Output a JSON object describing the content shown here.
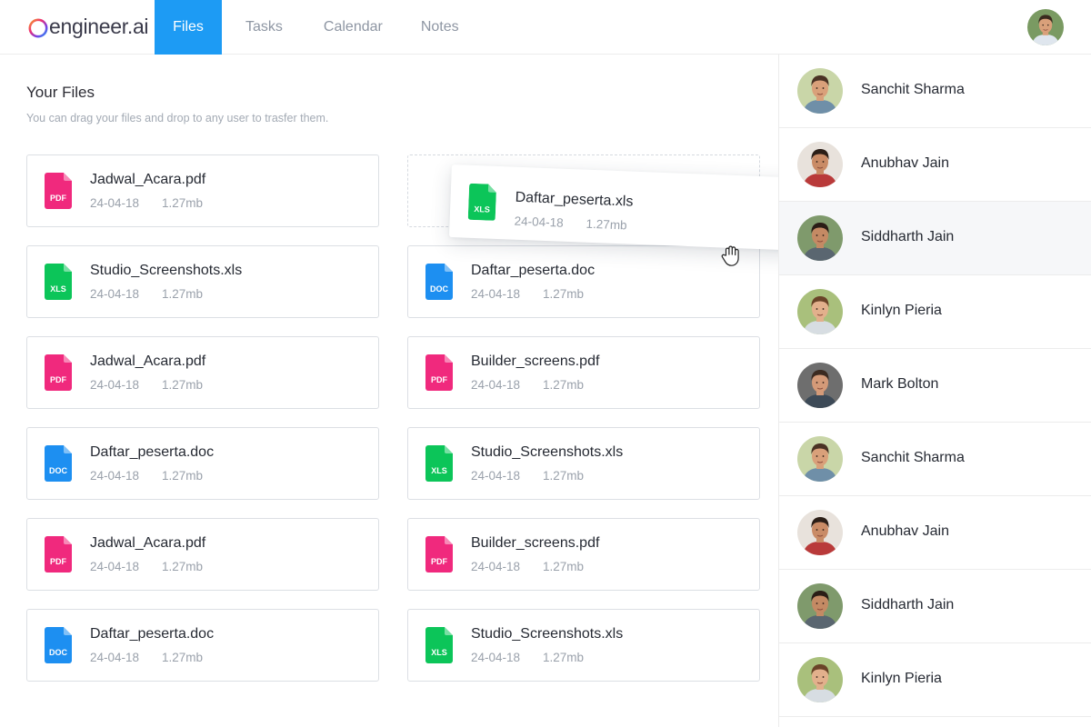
{
  "app": {
    "logo_text": "engineer.ai",
    "nav": [
      {
        "label": "Files",
        "active": true
      },
      {
        "label": "Tasks",
        "active": false
      },
      {
        "label": "Calendar",
        "active": false
      },
      {
        "label": "Notes",
        "active": false
      }
    ],
    "accent_color": "#1d9bf4"
  },
  "main": {
    "title": "Your Files",
    "subtitle": "You can drag your files and drop to any user to trasfer them."
  },
  "file_types": {
    "pdf": {
      "label": "PDF",
      "color": "#f0297d"
    },
    "xls": {
      "label": "XLS",
      "color": "#0cc559"
    },
    "doc": {
      "label": "DOC",
      "color": "#1d8ff1"
    }
  },
  "files": [
    {
      "name": "Jadwal_Acara.pdf",
      "type": "pdf",
      "date": "24-04-18",
      "size": "1.27mb"
    },
    {
      "name": "Studio_Screenshots.xls",
      "type": "xls",
      "date": "24-04-18",
      "size": "1.27mb"
    },
    {
      "name": "Daftar_peserta.doc",
      "type": "doc",
      "date": "24-04-18",
      "size": "1.27mb"
    },
    {
      "name": "Jadwal_Acara.pdf",
      "type": "pdf",
      "date": "24-04-18",
      "size": "1.27mb"
    },
    {
      "name": "Builder_screens.pdf",
      "type": "pdf",
      "date": "24-04-18",
      "size": "1.27mb"
    },
    {
      "name": "Daftar_peserta.doc",
      "type": "doc",
      "date": "24-04-18",
      "size": "1.27mb"
    },
    {
      "name": "Studio_Screenshots.xls",
      "type": "xls",
      "date": "24-04-18",
      "size": "1.27mb"
    },
    {
      "name": "Jadwal_Acara.pdf",
      "type": "pdf",
      "date": "24-04-18",
      "size": "1.27mb"
    },
    {
      "name": "Builder_screens.pdf",
      "type": "pdf",
      "date": "24-04-18",
      "size": "1.27mb"
    },
    {
      "name": "Daftar_peserta.doc",
      "type": "doc",
      "date": "24-04-18",
      "size": "1.27mb"
    },
    {
      "name": "Studio_Screenshots.xls",
      "type": "xls",
      "date": "24-04-18",
      "size": "1.27mb"
    }
  ],
  "dragged_file": {
    "name": "Daftar_peserta.xls",
    "type": "xls",
    "date": "24-04-18",
    "size": "1.27mb"
  },
  "users": [
    {
      "name": "Sanchit Sharma",
      "skin": "#d9a07a",
      "hair": "#4a3224",
      "bg": "#c9d6a8",
      "shirt": "#6f8fa8"
    },
    {
      "name": "Anubhav Jain",
      "skin": "#c98b66",
      "hair": "#2b1e17",
      "bg": "#e8e2dc",
      "shirt": "#b93a3a"
    },
    {
      "name": "Siddharth Jain",
      "skin": "#c48a64",
      "hair": "#2a1d16",
      "bg": "#7f9a6c",
      "shirt": "#5a6670",
      "highlighted": true
    },
    {
      "name": "Kinlyn Pieria",
      "skin": "#e2b08c",
      "hair": "#6a4428",
      "bg": "#a9c07c",
      "shirt": "#d7dde2"
    },
    {
      "name": "Mark Bolton",
      "skin": "#d49a78",
      "hair": "#3b2a20",
      "bg": "#6e6e6e",
      "shirt": "#3d4a57"
    },
    {
      "name": "Sanchit Sharma",
      "skin": "#d9a07a",
      "hair": "#4a3224",
      "bg": "#c9d6a8",
      "shirt": "#6f8fa8"
    },
    {
      "name": "Anubhav Jain",
      "skin": "#c98b66",
      "hair": "#2b1e17",
      "bg": "#e8e2dc",
      "shirt": "#b93a3a"
    },
    {
      "name": "Siddharth Jain",
      "skin": "#c48a64",
      "hair": "#2a1d16",
      "bg": "#7f9a6c",
      "shirt": "#5a6670"
    },
    {
      "name": "Kinlyn Pieria",
      "skin": "#e2b08c",
      "hair": "#6a4428",
      "bg": "#a9c07c",
      "shirt": "#d7dde2"
    }
  ],
  "current_user": {
    "skin": "#d9a07a",
    "hair": "#3a2a1e",
    "bg": "#7a9a62",
    "shirt": "#dfe6ee"
  }
}
